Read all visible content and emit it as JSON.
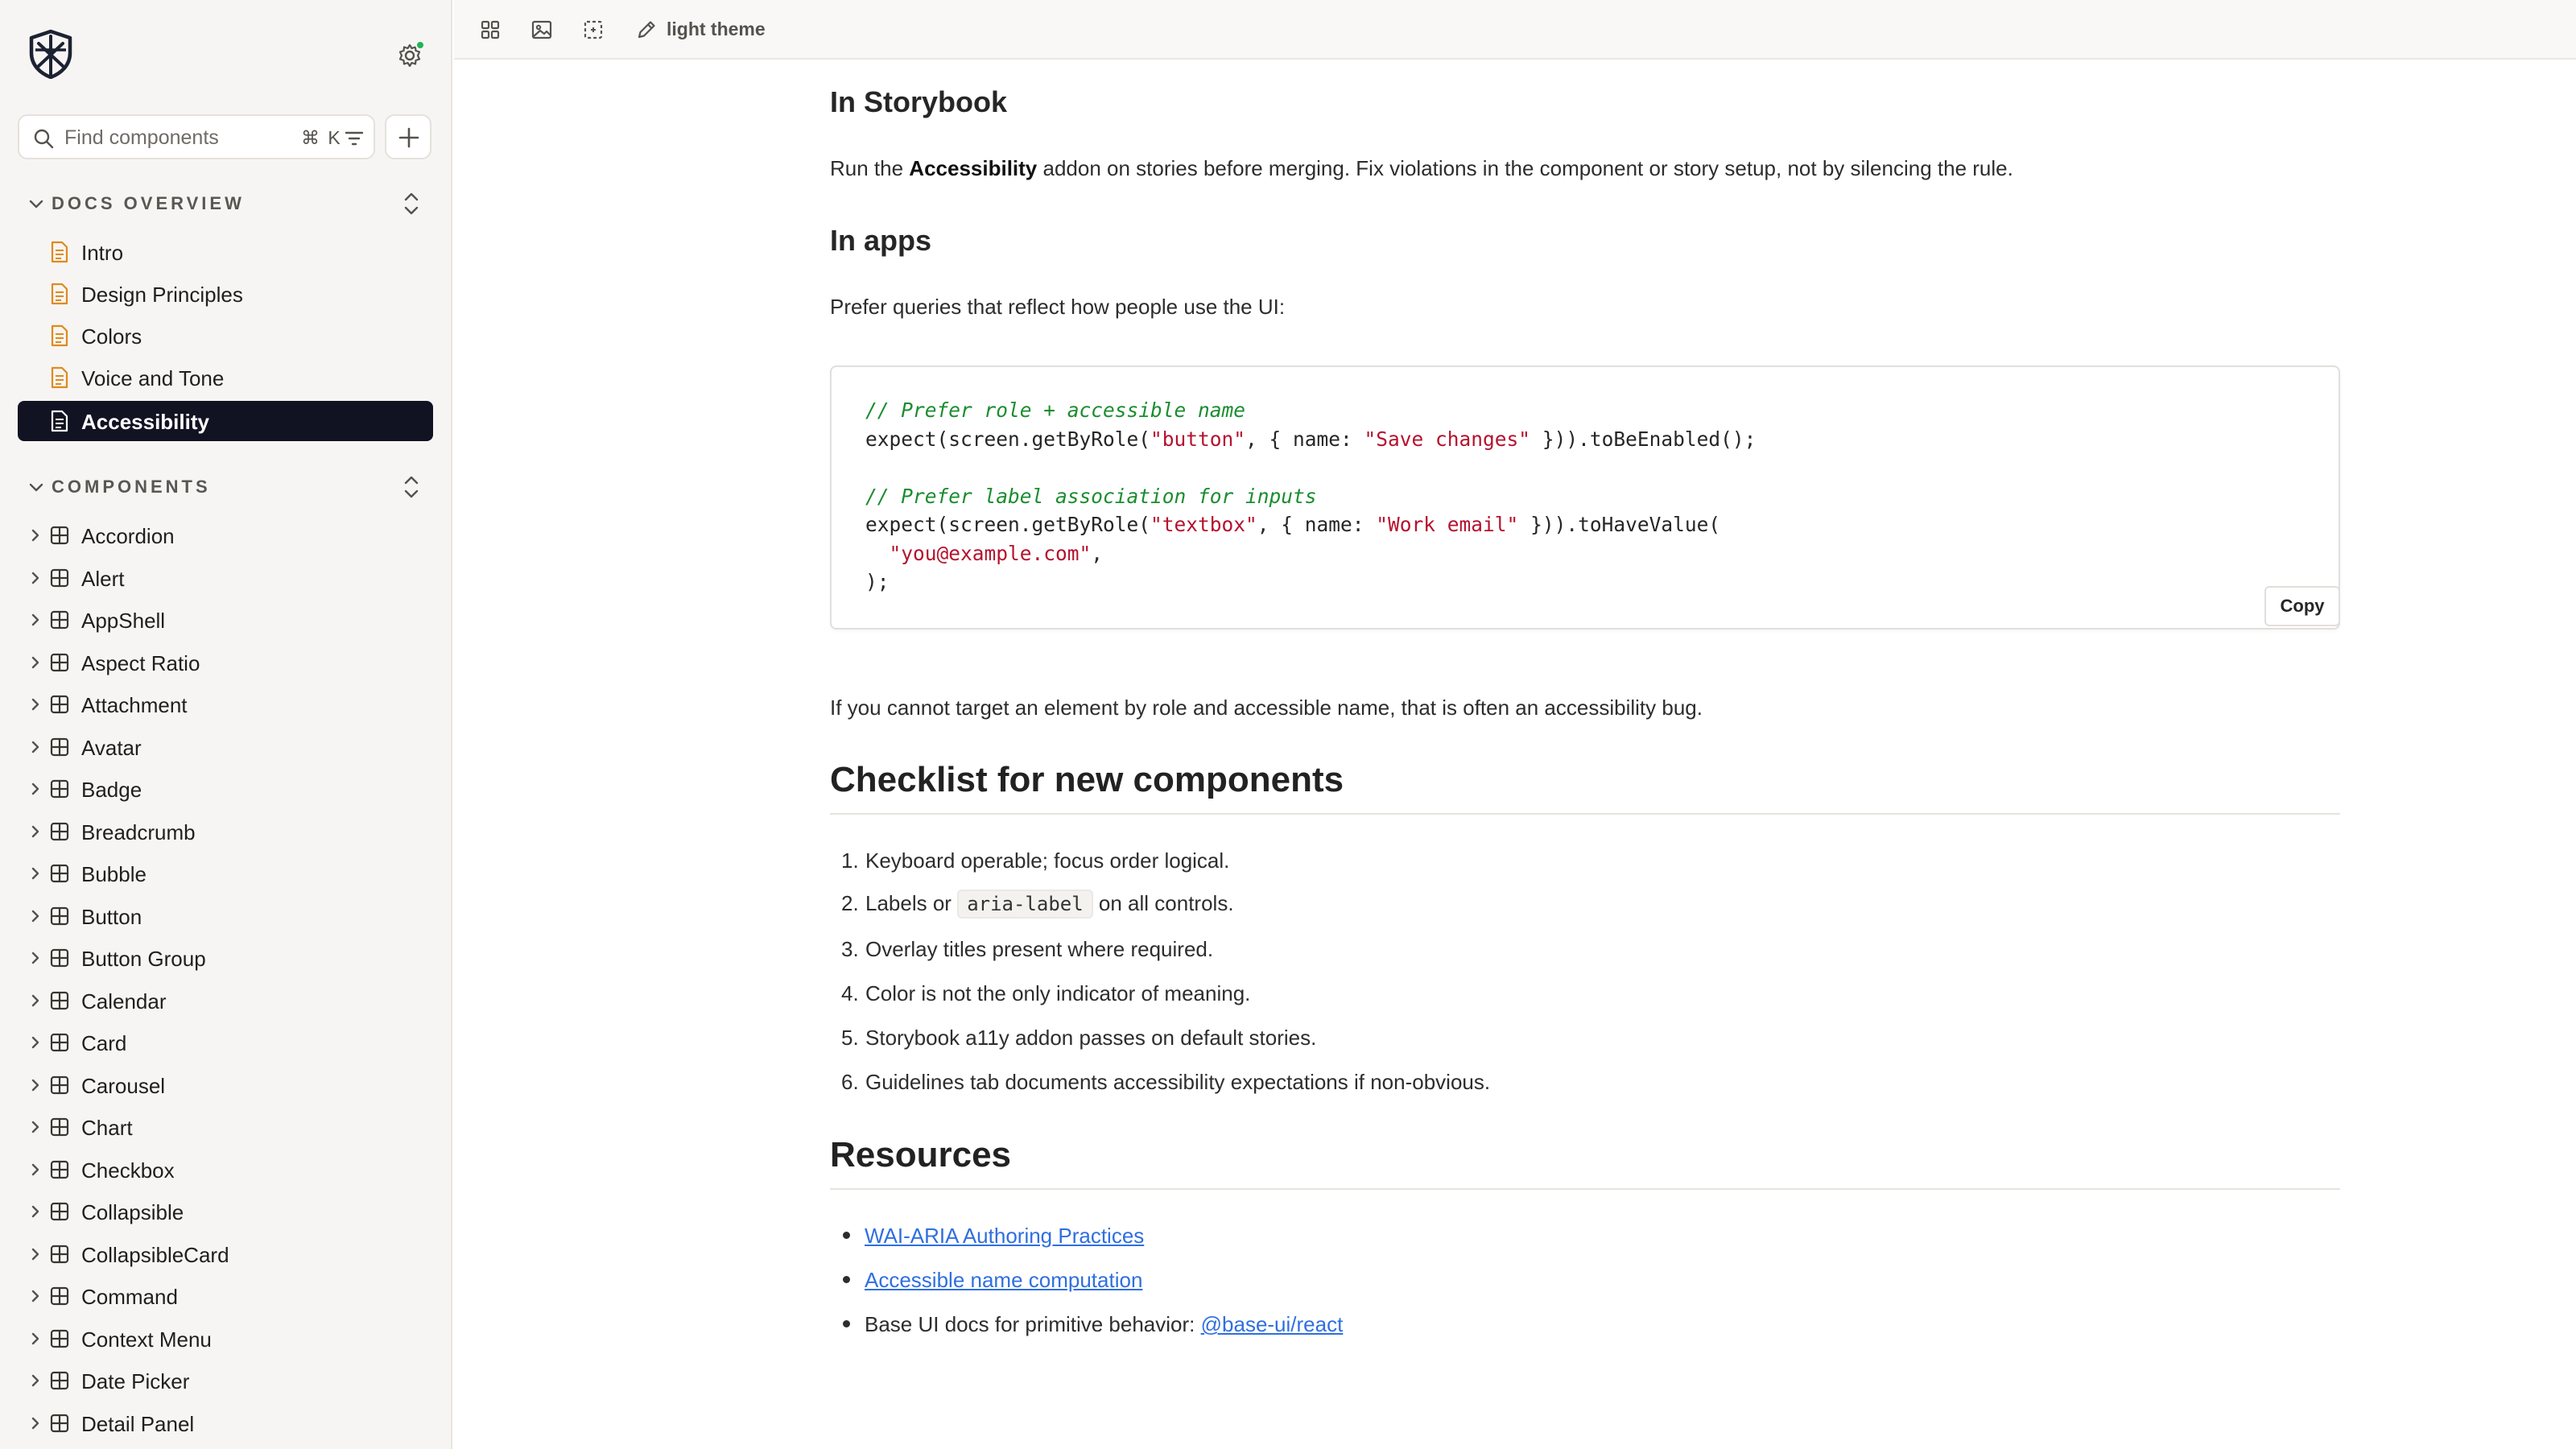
{
  "sidebar": {
    "search": {
      "placeholder": "Find components",
      "shortcut": "⌘ K"
    },
    "docs_section": {
      "label": "DOCS OVERVIEW"
    },
    "docs": [
      {
        "label": "Intro"
      },
      {
        "label": "Design Principles"
      },
      {
        "label": "Colors"
      },
      {
        "label": "Voice and Tone"
      },
      {
        "label": "Accessibility",
        "active": true
      }
    ],
    "components_section": {
      "label": "COMPONENTS"
    },
    "components": [
      "Accordion",
      "Alert",
      "AppShell",
      "Aspect Ratio",
      "Attachment",
      "Avatar",
      "Badge",
      "Breadcrumb",
      "Bubble",
      "Button",
      "Button Group",
      "Calendar",
      "Card",
      "Carousel",
      "Chart",
      "Checkbox",
      "Collapsible",
      "CollapsibleCard",
      "Command",
      "Context Menu",
      "Date Picker",
      "Detail Panel"
    ]
  },
  "toolbar": {
    "theme_label": "light theme"
  },
  "content": {
    "h_storybook": "In Storybook",
    "p_storybook": {
      "pre": "Run the ",
      "bold": "Accessibility",
      "post": " addon on stories before merging. Fix violations in the component or story setup, not by silencing the rule."
    },
    "h_apps": "In apps",
    "p_apps": "Prefer queries that reflect how people use the UI:",
    "code": {
      "comment1": "// Prefer role + accessible name",
      "line1_a": "expect(screen.getByRole(",
      "line1_s1": "\"button\"",
      "line1_b": ", { name: ",
      "line1_s2": "\"Save changes\"",
      "line1_c": " })).toBeEnabled();",
      "comment2": "// Prefer label association for inputs",
      "line2_a": "expect(screen.getByRole(",
      "line2_s1": "\"textbox\"",
      "line2_b": ", { name: ",
      "line2_s2": "\"Work email\"",
      "line2_c": " })).toHaveValue(",
      "line3_s": "\"you@example.com\"",
      "line3_c": ",",
      "line4": ");",
      "copy_label": "Copy"
    },
    "p_target": "If you cannot target an element by role and accessible name, that is often an accessibility bug.",
    "h_checklist": "Checklist for new components",
    "checklist": [
      {
        "num": "1.",
        "text": "Keyboard operable; focus order logical."
      },
      {
        "num": "2.",
        "pre": "Labels or ",
        "code": "aria-label",
        "post": " on all controls."
      },
      {
        "num": "3.",
        "text": "Overlay titles present where required."
      },
      {
        "num": "4.",
        "text": "Color is not the only indicator of meaning."
      },
      {
        "num": "5.",
        "text": "Storybook a11y addon passes on default stories."
      },
      {
        "num": "6.",
        "text": "Guidelines tab documents accessibility expectations if non-obvious."
      }
    ],
    "h_resources": "Resources",
    "resources": {
      "link1": "WAI-ARIA Authoring Practices",
      "link2": "Accessible name computation",
      "item3_pre": "Base UI docs for primitive behavior: ",
      "item3_link": "@base-ui/react"
    }
  }
}
